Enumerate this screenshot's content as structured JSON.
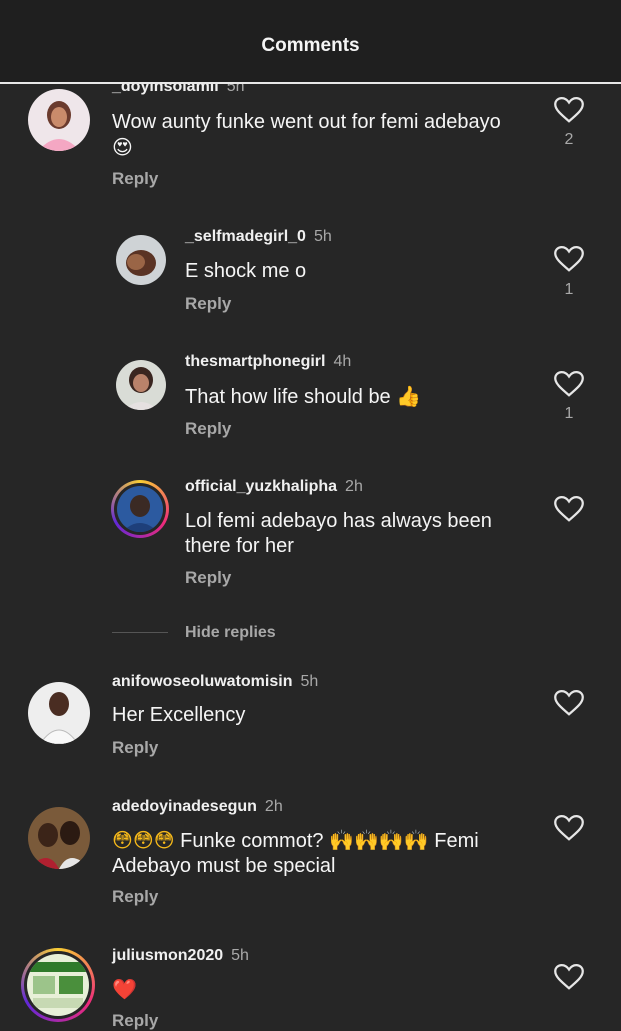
{
  "header": {
    "title": "Comments"
  },
  "comments": [
    {
      "username": "_doyinsolamii",
      "time": "5h",
      "text": "Wow aunty funke went out for femi adebayo",
      "emoji": "😍",
      "reply": "Reply",
      "likes": "2"
    },
    {
      "username": "_selfmadegirl_0",
      "time": "5h",
      "text": "E shock me o",
      "reply": "Reply",
      "likes": "1"
    },
    {
      "username": "thesmartphonegirl",
      "time": "4h",
      "text": "That how life should be",
      "emoji": "👍",
      "reply": "Reply",
      "likes": "1"
    },
    {
      "username": "official_yuzkhalipha",
      "time": "2h",
      "text_line1": "Lol femi adebayo  has always been",
      "text_line2": "there for her",
      "reply": "Reply"
    },
    {
      "username": "anifowoseoluwatomisin",
      "time": "5h",
      "text": "Her Excellency",
      "reply": "Reply"
    },
    {
      "username": "adedoyinadesegun",
      "time": "2h",
      "emoji_prefix": "😳😳😳",
      "text_line1": "Funke commot?",
      "emoji_mid": "🙌🙌🙌🙌",
      "text_line1b": "Femi",
      "text_line2": "Adebayo must be special",
      "reply": "Reply"
    },
    {
      "username": "juliusmon2020",
      "time": "5h",
      "emoji": "❤️",
      "reply": "Reply"
    }
  ],
  "hide_replies": "Hide replies",
  "colors": {
    "background": "#262626",
    "header": "#1f1f1f",
    "muted": "#a8a8a8",
    "heart_red": "#e0182d"
  },
  "icons": {
    "like": "heart-outline-icon"
  }
}
